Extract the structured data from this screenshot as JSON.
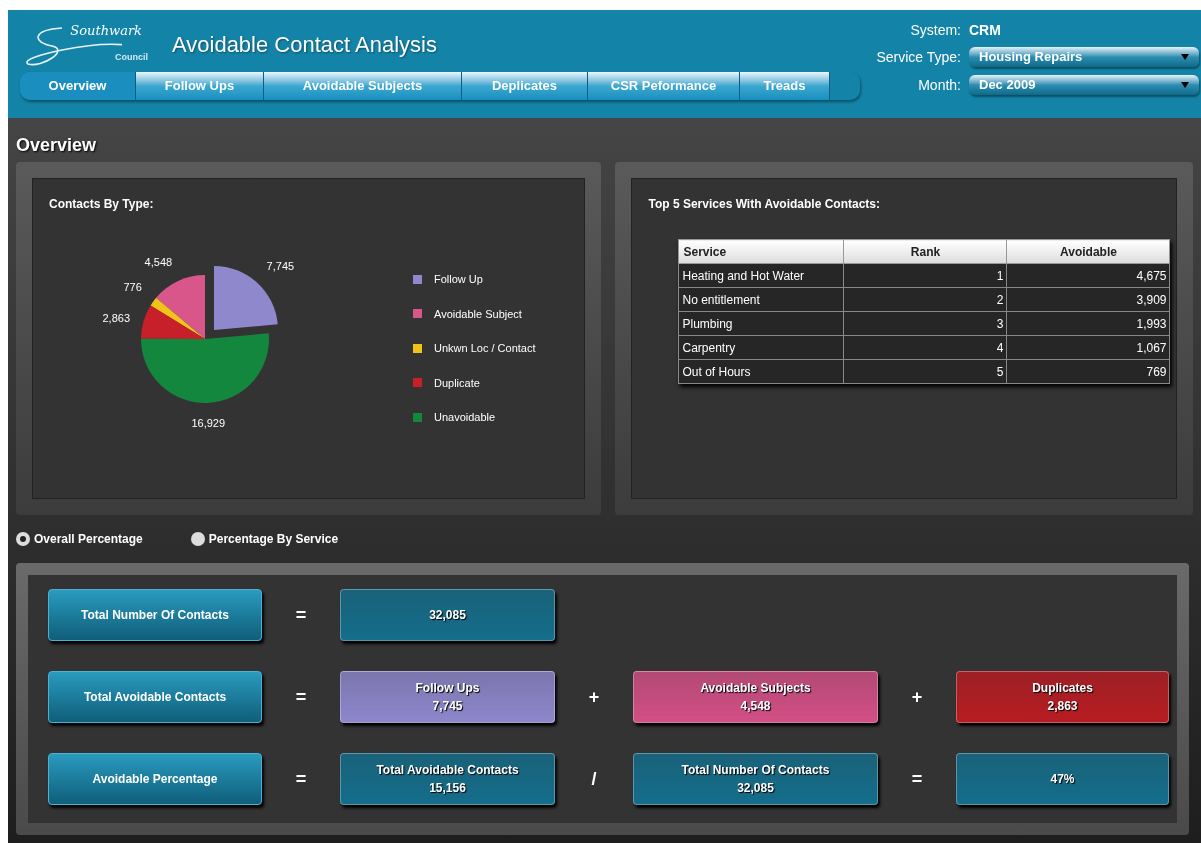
{
  "logo": {
    "script": "Southwark",
    "sub": "Council"
  },
  "title": "Avoidable Contact Analysis",
  "tabs": [
    {
      "label": "Overview",
      "selected": true
    },
    {
      "label": "Follow Ups",
      "selected": false
    },
    {
      "label": "Avoidable Subjects",
      "selected": false
    },
    {
      "label": "Deplicates",
      "selected": false
    },
    {
      "label": "CSR Peformance",
      "selected": false
    },
    {
      "label": "Treads",
      "selected": false
    }
  ],
  "filters": {
    "system_label": "System:",
    "system_value": "CRM",
    "service_label": "Service Type:",
    "service_value": "Housing Repairs",
    "month_label": "Month:",
    "month_value": "Dec 2009"
  },
  "heading": "Overview",
  "contacts_panel": {
    "title": "Contacts By Type:",
    "chart_data": {
      "type": "pie",
      "categories": [
        "Follow Up",
        "Avoidable Subject",
        "Unkwn Loc / Contact",
        "Duplicate",
        "Unavoidable"
      ],
      "values": [
        7745,
        4548,
        776,
        2863,
        16929
      ],
      "value_labels": [
        "7,745",
        "4,548",
        "776",
        "2,863",
        "16,929"
      ]
    },
    "legend": [
      {
        "color": "#8f88cc"
      },
      {
        "color": "#d9568a"
      },
      {
        "color": "#f2c21b"
      },
      {
        "color": "#c8202a"
      },
      {
        "color": "#13873e"
      }
    ]
  },
  "top5_panel": {
    "title": "Top 5 Services With Avoidable Contacts:",
    "columns": [
      "Service",
      "Rank",
      "Avoidable"
    ],
    "rows": [
      [
        "Heating and Hot Water",
        "1",
        "4,675"
      ],
      [
        "No entitlement",
        "2",
        "3,909"
      ],
      [
        "Plumbing",
        "3",
        "1,993"
      ],
      [
        "Carpentry",
        "4",
        "1,067"
      ],
      [
        "Out of Hours",
        "5",
        "769"
      ]
    ]
  },
  "view_options": [
    {
      "label": "Overall Percentage",
      "selected": true
    },
    {
      "label": "Percentage By Service",
      "selected": false
    }
  ],
  "formulas": [
    {
      "label": "Total Number Of Contacts",
      "parts": [
        {
          "kind": "operator",
          "text": "="
        },
        {
          "kind": "value",
          "color": "#146e8c",
          "value": "32,085"
        }
      ]
    },
    {
      "label": "Total Avoidable Contacts",
      "parts": [
        {
          "kind": "operator",
          "text": "="
        },
        {
          "kind": "value",
          "color": "#8e87cc",
          "title": "Follow Ups",
          "value": "7,745"
        },
        {
          "kind": "operator",
          "text": "+"
        },
        {
          "kind": "value",
          "color": "#d34f86",
          "title": "Avoidable Subjects",
          "value": "4,548"
        },
        {
          "kind": "operator",
          "text": "+"
        },
        {
          "kind": "value",
          "color": "#b81c22",
          "title": "Duplicates",
          "value": "2,863"
        }
      ]
    },
    {
      "label": "Avoidable Percentage",
      "parts": [
        {
          "kind": "operator",
          "text": "="
        },
        {
          "kind": "value",
          "color": "#146e8c",
          "title": "Total Avoidable Contacts",
          "value": "15,156"
        },
        {
          "kind": "operator",
          "text": "/"
        },
        {
          "kind": "value",
          "color": "#146e8c",
          "title": "Total Number Of Contacts",
          "value": "32,085"
        },
        {
          "kind": "operator",
          "text": "="
        },
        {
          "kind": "value",
          "color": "#146e8c",
          "value": "47%"
        }
      ]
    }
  ]
}
